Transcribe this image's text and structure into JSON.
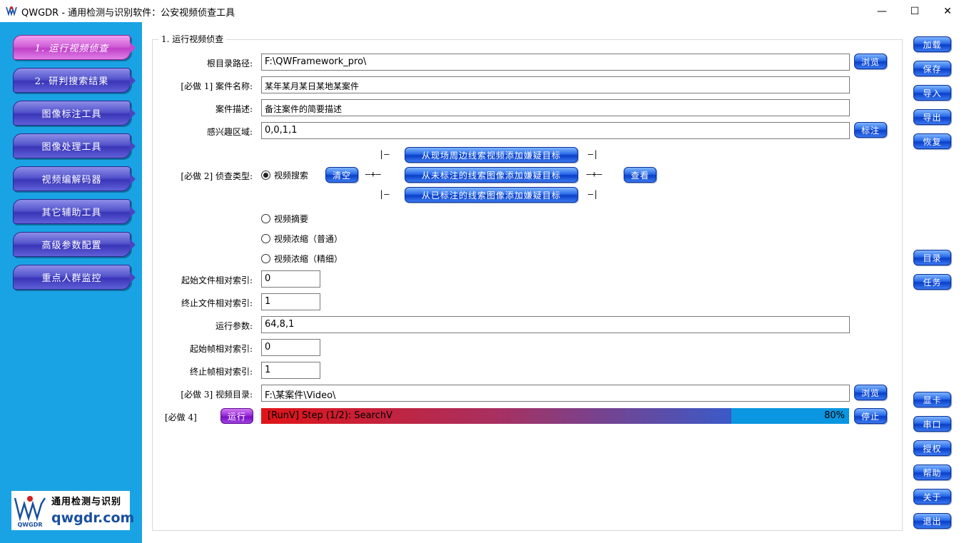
{
  "window": {
    "title": "QWGDR - 通用检测与识别软件：公安视频侦查工具",
    "minimize": "—",
    "maximize": "☐",
    "close": "✕"
  },
  "sidebar": {
    "items": [
      {
        "label": "1. 运行视频侦查",
        "active": true
      },
      {
        "label": "2. 研判搜索结果"
      },
      {
        "label": "图像标注工具"
      },
      {
        "label": "图像处理工具"
      },
      {
        "label": "视频编解码器"
      },
      {
        "label": "其它辅助工具"
      },
      {
        "label": "高级参数配置"
      },
      {
        "label": "重点人群监控"
      }
    ],
    "logo": {
      "cn": "通用检测与识别",
      "en": "qwgdr.com",
      "mark": "QWGDR"
    }
  },
  "main": {
    "legend": "1. 运行视频侦查",
    "root_label": "根目录路径:",
    "root_value": "F:\\QWFramework_pro\\",
    "browse_label": "浏览",
    "case_name_label": "[必做 1] 案件名称:",
    "case_name_value": "某年某月某日某地某案件",
    "case_desc_label": "案件描述:",
    "case_desc_value": "备注案件的简要描述",
    "roi_label": "感兴趣区域:",
    "roi_value": "0,0,1,1",
    "annotate_label": "标注",
    "type_label": "[必做 2] 侦查类型:",
    "radio_search": "视频搜索",
    "clear_label": "清空",
    "add_from_scene": "从现场周边线索视频添加嫌疑目标",
    "add_from_unlabeled": "从未标注的线索图像添加嫌疑目标",
    "add_from_labeled": "从已标注的线索图像添加嫌疑目标",
    "view_label": "查看",
    "conn_top_left": "|—",
    "conn_top_right": "—|",
    "conn_mid_left": "—+—",
    "conn_mid_right": "—+—",
    "conn_bot_left": "|—",
    "conn_bot_right": "—|",
    "radio_summary": "视频摘要",
    "radio_condense_normal": "视频浓缩（普通）",
    "radio_condense_fine": "视频浓缩（精细）",
    "start_file_label": "起始文件相对索引:",
    "start_file_value": "0",
    "end_file_label": "终止文件相对索引:",
    "end_file_value": "1",
    "run_params_label": "运行参数:",
    "run_params_value": "64,8,1",
    "start_frame_label": "起始帧相对索引:",
    "start_frame_value": "0",
    "end_frame_label": "终止帧相对索引:",
    "end_frame_value": "1",
    "video_dir_label": "[必做 3] 视频目录:",
    "video_dir_value": "F:\\某案件\\Video\\",
    "browse2_label": "浏览",
    "step4_label": "[必做 4]",
    "run_label": "运行",
    "progress_text": "[RunV] Step (1/2): SearchV",
    "progress_percent_text": "80%",
    "progress_value": 0.8,
    "stop_label": "停止"
  },
  "right": {
    "load": "加载",
    "save": "保存",
    "import": "导入",
    "export": "导出",
    "restore": "恢复",
    "catalog": "目录",
    "task": "任务",
    "gpu": "显卡",
    "serial": "串口",
    "license": "授权",
    "help": "帮助",
    "about": "关于",
    "exit": "退出"
  }
}
